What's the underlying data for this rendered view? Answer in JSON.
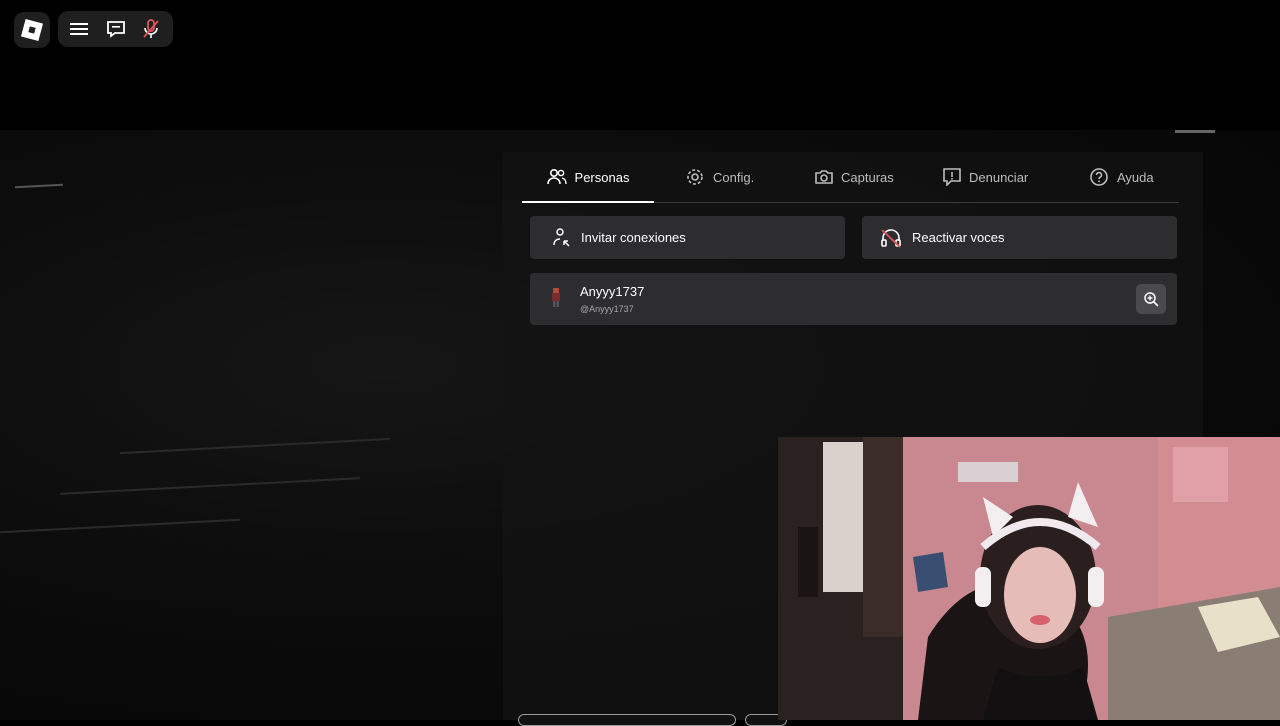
{
  "topbar": {
    "logo_icon": "roblox-logo",
    "menu_icon": "hamburger-menu-icon",
    "chat_icon": "chat-icon",
    "mic_icon": "microphone-muted-icon",
    "mic_color": "#e0555d"
  },
  "panel": {
    "tabs": [
      {
        "label": "Personas",
        "icon": "people-icon",
        "active": true
      },
      {
        "label": "Config.",
        "icon": "gear-icon",
        "active": false
      },
      {
        "label": "Capturas",
        "icon": "camera-icon",
        "active": false
      },
      {
        "label": "Denunciar",
        "icon": "report-icon",
        "active": false
      },
      {
        "label": "Ayuda",
        "icon": "help-icon",
        "active": false
      }
    ],
    "actions": {
      "invite_label": "Invitar conexiones",
      "invite_icon": "invite-user-icon",
      "voice_label": "Reactivar voces",
      "voice_icon": "headphones-muted-icon"
    },
    "players": [
      {
        "display_name": "Anyyy1737",
        "username": "@Anyyy1737",
        "action_icon": "inspect-zoom-icon"
      }
    ]
  },
  "webcam": {
    "description_icon": "webcam-overlay"
  }
}
